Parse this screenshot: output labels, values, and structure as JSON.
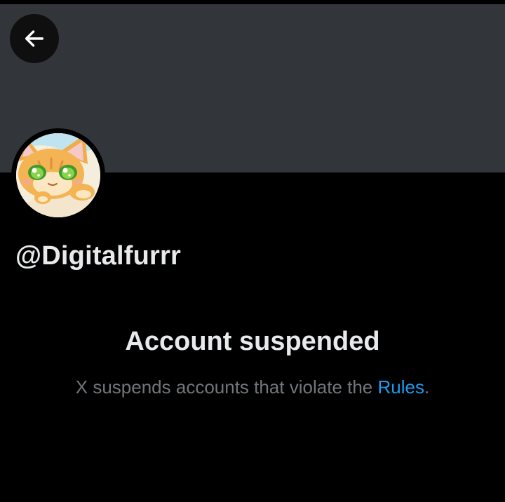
{
  "header": {
    "back_icon": "arrow-left-icon"
  },
  "profile": {
    "avatar_icon": "cat-avatar-illustration",
    "handle": "@Digitalfurrr"
  },
  "status": {
    "title": "Account suspended",
    "description_prefix": "X suspends accounts that violate the ",
    "rules_link": "Rules",
    "description_suffix": "."
  },
  "colors": {
    "background": "#000000",
    "banner": "#323539",
    "primary_text": "#e7e9ea",
    "secondary_text": "#71767b",
    "link": "#1d9bf0"
  }
}
